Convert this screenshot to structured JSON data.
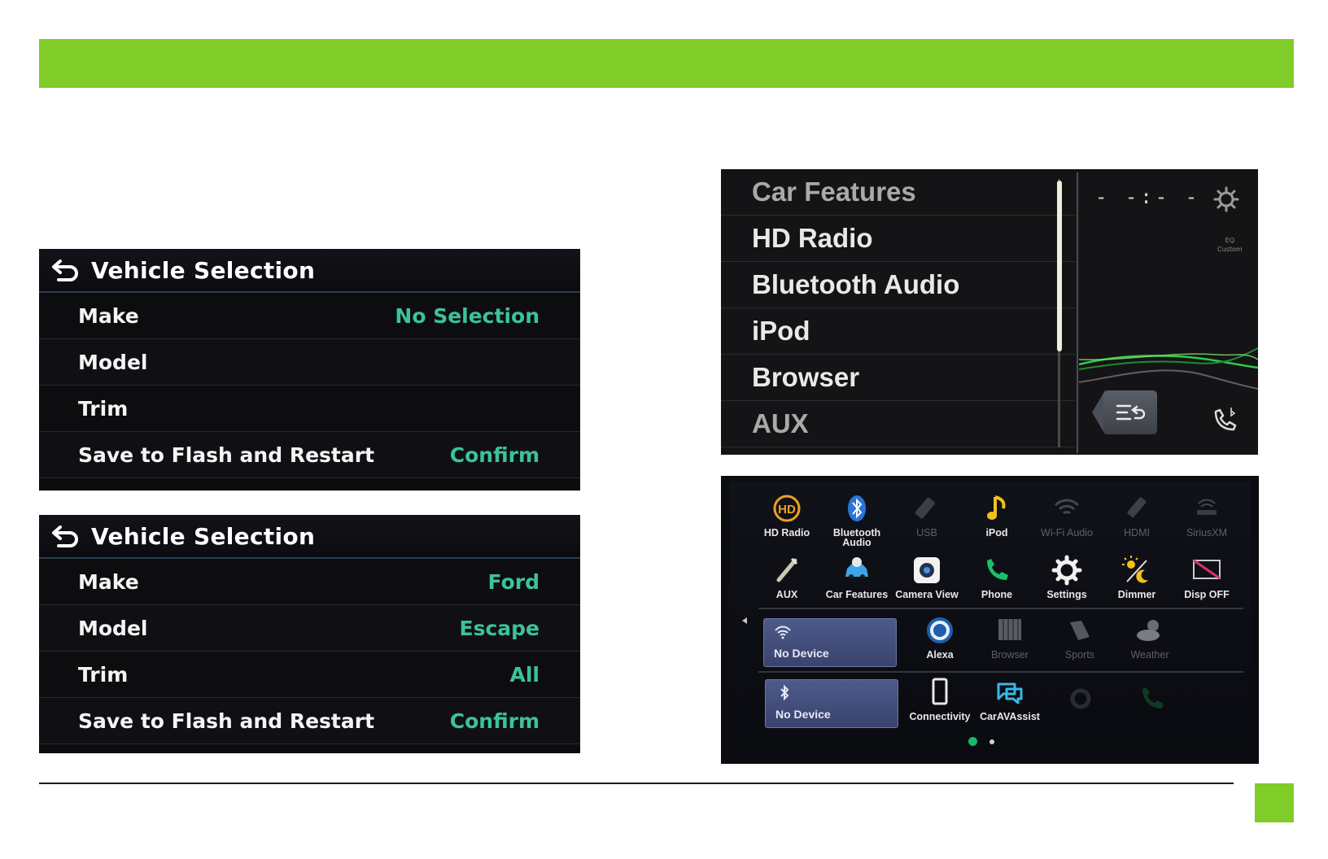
{
  "colors": {
    "accent_green": "#80cc28",
    "value_teal": "#3cc29a",
    "panel_bg": "#0c0c0f"
  },
  "vehicle_selection_1": {
    "title": "Vehicle Selection",
    "rows": [
      {
        "label": "Make",
        "value": "No Selection"
      },
      {
        "label": "Model",
        "value": ""
      },
      {
        "label": "Trim",
        "value": ""
      },
      {
        "label": "Save to Flash and Restart",
        "value": "Confirm"
      }
    ]
  },
  "vehicle_selection_2": {
    "title": "Vehicle Selection",
    "rows": [
      {
        "label": "Make",
        "value": "Ford"
      },
      {
        "label": "Model",
        "value": "Escape"
      },
      {
        "label": "Trim",
        "value": "All"
      },
      {
        "label": "Save to Flash and Restart",
        "value": "Confirm"
      }
    ]
  },
  "source_list": {
    "items": [
      "Car Features",
      "HD Radio",
      "Bluetooth Audio",
      "iPod",
      "Browser",
      "AUX"
    ],
    "time": "- -:- -",
    "eq_label": "EQ",
    "eq_preset": "Custom"
  },
  "home_screen": {
    "row1": [
      {
        "label": "HD Radio",
        "icon": "hd-radio-icon"
      },
      {
        "label": "Bluetooth Audio",
        "icon": "bluetooth-icon"
      },
      {
        "label": "USB",
        "icon": "usb-icon"
      },
      {
        "label": "iPod",
        "icon": "music-note-icon"
      },
      {
        "label": "Wi-Fi Audio",
        "icon": "wifi-audio-icon"
      },
      {
        "label": "HDMI",
        "icon": "hdmi-icon"
      },
      {
        "label": "SiriusXM",
        "icon": "siriusxm-icon"
      }
    ],
    "row2": [
      {
        "label": "AUX",
        "icon": "aux-cable-icon"
      },
      {
        "label": "Car Features",
        "icon": "car-icon"
      },
      {
        "label": "Camera View",
        "icon": "camera-icon"
      },
      {
        "label": "Phone",
        "icon": "phone-icon"
      },
      {
        "label": "Settings",
        "icon": "settings-gear-icon"
      },
      {
        "label": "Dimmer",
        "icon": "dimmer-icon"
      },
      {
        "label": "Disp OFF",
        "icon": "display-off-icon"
      }
    ],
    "row3": [
      {
        "label": "Alexa",
        "icon": "alexa-icon"
      },
      {
        "label": "Browser",
        "icon": "browser-icon"
      },
      {
        "label": "Sports",
        "icon": "sports-icon"
      },
      {
        "label": "Weather",
        "icon": "weather-icon"
      }
    ],
    "row4": [
      {
        "label": "Connectivity",
        "icon": "connectivity-icon"
      },
      {
        "label": "CarAVAssist",
        "icon": "caravassist-icon"
      }
    ],
    "wifi_device": "No Device",
    "bt_device": "No Device"
  }
}
